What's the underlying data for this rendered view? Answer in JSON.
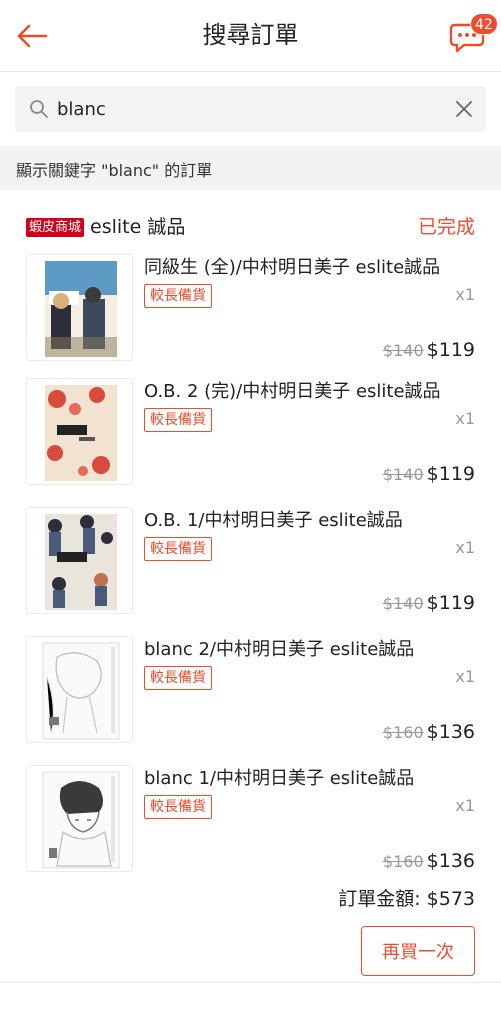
{
  "header": {
    "title": "搜尋訂單",
    "chat_badge_count": "42"
  },
  "search": {
    "value": "blanc",
    "placeholder": ""
  },
  "result_hint": "顯示關鍵字 \"blanc\" 的訂單",
  "order": {
    "mall_badge": "蝦皮商城",
    "shop_name": "eslite 誠品",
    "status": "已完成",
    "items": [
      {
        "name": "同級生 (全)/中村明日美子 eslite誠品",
        "tag": "較長備貨",
        "qty": "x1",
        "original_price": "$140",
        "price": "$119"
      },
      {
        "name": "O.B. 2 (完)/中村明日美子 eslite誠品",
        "tag": "較長備貨",
        "qty": "x1",
        "original_price": "$140",
        "price": "$119"
      },
      {
        "name": "O.B. 1/中村明日美子 eslite誠品",
        "tag": "較長備貨",
        "qty": "x1",
        "original_price": "$140",
        "price": "$119"
      },
      {
        "name": "blanc 2/中村明日美子 eslite誠品",
        "tag": "較長備貨",
        "qty": "x1",
        "original_price": "$160",
        "price": "$136"
      },
      {
        "name": "blanc 1/中村明日美子 eslite誠品",
        "tag": "較長備貨",
        "qty": "x1",
        "original_price": "$160",
        "price": "$136"
      }
    ],
    "total": "訂單金額: $573",
    "buy_again_label": "再買一次"
  },
  "colors": {
    "accent": "#ee4d2d",
    "mall_badge": "#d0011b"
  },
  "icons": {
    "back": "back-arrow-icon",
    "chat": "chat-bubble-icon",
    "search": "search-icon",
    "clear": "close-icon"
  }
}
